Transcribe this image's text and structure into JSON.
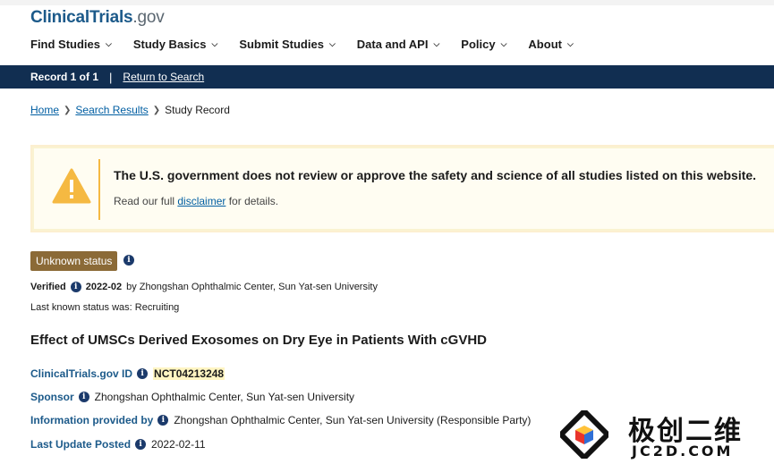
{
  "header": {
    "logo_main": "ClinicalTrials",
    "logo_suffix": ".gov",
    "nav": [
      "Find Studies",
      "Study Basics",
      "Submit Studies",
      "Data and API",
      "Policy",
      "About"
    ]
  },
  "recordbar": {
    "record": "Record 1 of 1",
    "separator": "|",
    "return_link": "Return to Search"
  },
  "breadcrumb": {
    "home": "Home",
    "results": "Search Results",
    "current": "Study Record"
  },
  "alert": {
    "title": "The U.S. government does not review or approve the safety and science of all studies listed on this website.",
    "text_before": "Read our full ",
    "link": "disclaimer",
    "text_after": " for details.",
    "icon": "warning-icon",
    "accent": "#f5b942"
  },
  "study": {
    "status": "Unknown status",
    "status_color": "#8b6a37",
    "verified_label": "Verified",
    "verified_date": "2022-02",
    "verified_by": "by Zhongshan Ophthalmic Center, Sun Yat-sen University",
    "last_known": "Last known status was: Recruiting",
    "title": "Effect of UMSCs Derived Exosomes on Dry Eye in Patients With cGVHD",
    "id_label": "ClinicalTrials.gov ID",
    "id_value": "NCT04213248",
    "sponsor_label": "Sponsor",
    "sponsor_value": "Zhongshan Ophthalmic Center, Sun Yat-sen University",
    "provided_label": "Information provided by",
    "provided_value": "Zhongshan Ophthalmic Center, Sun Yat-sen University (Responsible Party)",
    "update_label": "Last Update Posted",
    "update_value": "2022-02-11"
  },
  "watermark": {
    "cn": "极创二维",
    "en": "JC2D.COM"
  }
}
